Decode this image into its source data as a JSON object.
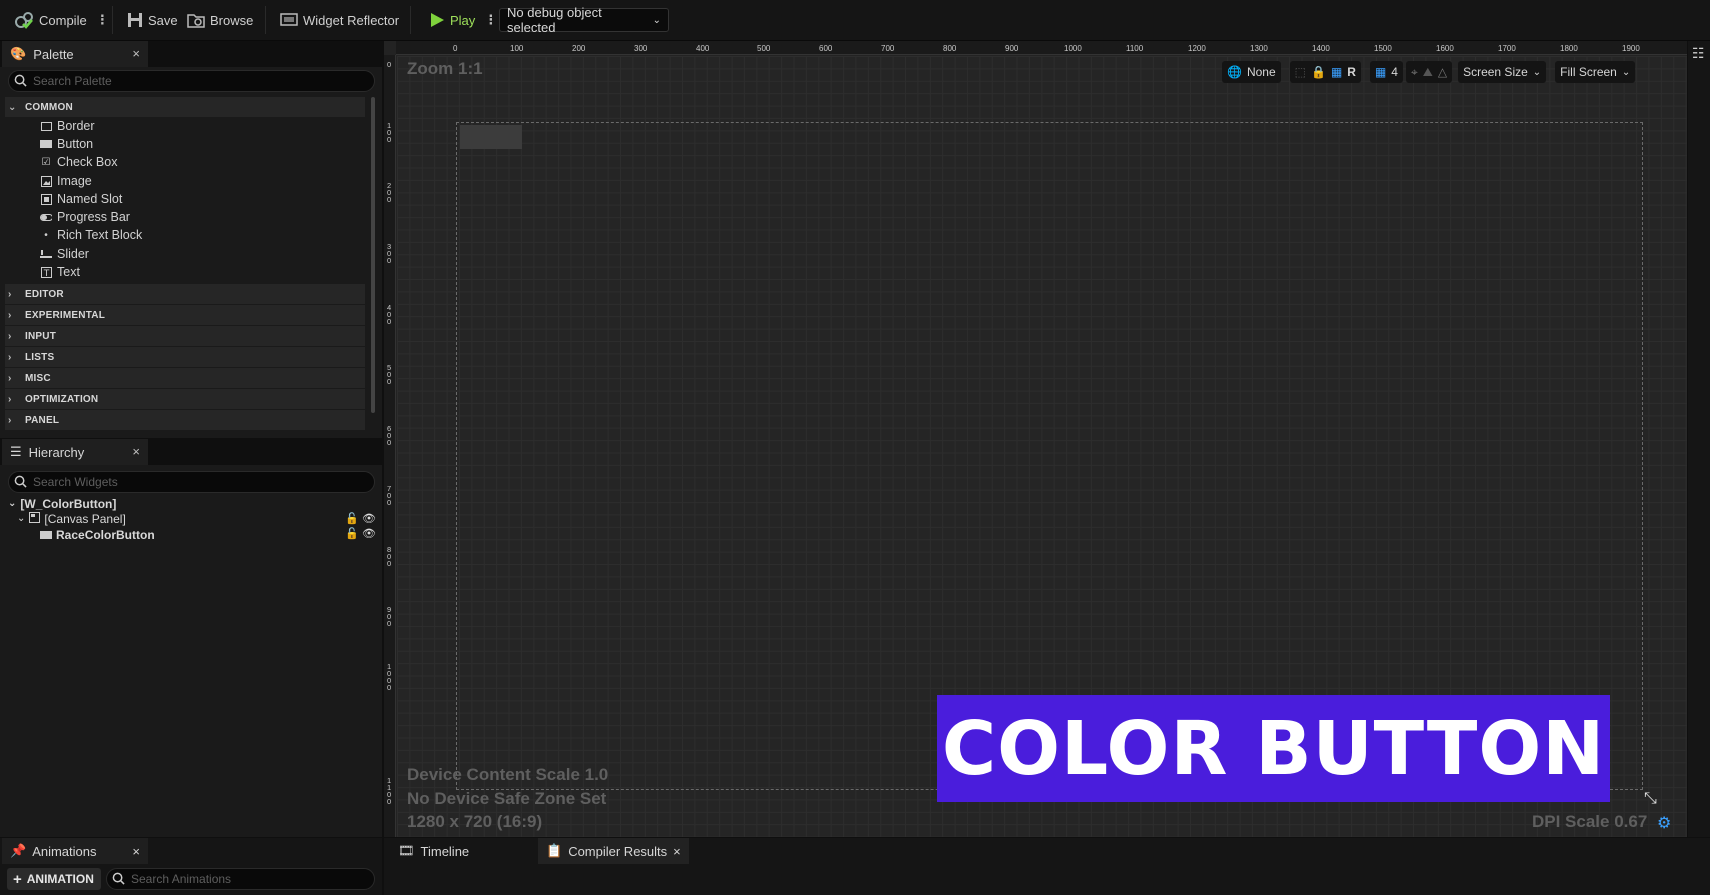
{
  "toolbar": {
    "compile_label": "Compile",
    "save_label": "Save",
    "browse_label": "Browse",
    "widget_reflector_label": "Widget Reflector",
    "play_label": "Play",
    "debug_object": "No debug object selected",
    "play_color": "#7fd23c"
  },
  "palette": {
    "tab_label": "Palette",
    "close": "×",
    "search_placeholder": "Search Palette",
    "common_label": "COMMON",
    "common_items": [
      {
        "label": "Border",
        "icon": "border-icon"
      },
      {
        "label": "Button",
        "icon": "button-icon"
      },
      {
        "label": "Check Box",
        "icon": "checkbox-icon"
      },
      {
        "label": "Image",
        "icon": "image-icon"
      },
      {
        "label": "Named Slot",
        "icon": "named-slot-icon"
      },
      {
        "label": "Progress Bar",
        "icon": "progress-bar-icon"
      },
      {
        "label": "Rich Text Block",
        "icon": "rich-text-icon"
      },
      {
        "label": "Slider",
        "icon": "slider-icon"
      },
      {
        "label": "Text",
        "icon": "text-icon"
      }
    ],
    "categories": [
      "EDITOR",
      "EXPERIMENTAL",
      "INPUT",
      "LISTS",
      "MISC",
      "OPTIMIZATION",
      "PANEL"
    ]
  },
  "hierarchy": {
    "tab_label": "Hierarchy",
    "close": "×",
    "search_placeholder": "Search Widgets",
    "root": "[W_ColorButton]",
    "canvas": "[Canvas Panel]",
    "child": "RaceColorButton"
  },
  "designer": {
    "zoom": "Zoom 1:1",
    "top_ruler": [
      "0",
      "100",
      "200",
      "300",
      "400",
      "500",
      "600",
      "700",
      "800",
      "900",
      "1000",
      "1100",
      "1200",
      "1300",
      "1400",
      "1500",
      "1600",
      "1700",
      "1800",
      "1900"
    ],
    "left_ruler": [
      "0",
      "100",
      "200",
      "300",
      "400",
      "500",
      "600",
      "700",
      "800",
      "900",
      "1000",
      "1100"
    ],
    "none_label": "None",
    "r_label": "R",
    "grid_count": "4",
    "screen_size": "Screen Size",
    "fill_screen": "Fill Screen",
    "device_scale": "Device Content Scale 1.0",
    "safe_zone": "No Device Safe Zone Set",
    "resolution": "1280 x 720 (16:9)",
    "dpi_scale": "DPI Scale 0.67"
  },
  "overlay": {
    "title": "COLOR BUTTON",
    "color": "#4a1ddc"
  },
  "bottom": {
    "animations_tab": "Animations",
    "close": "×",
    "animation_button": "ANIMATION",
    "animation_search_placeholder": "Search Animations",
    "timeline_tab": "Timeline",
    "compiler_results_tab": "Compiler Results"
  }
}
